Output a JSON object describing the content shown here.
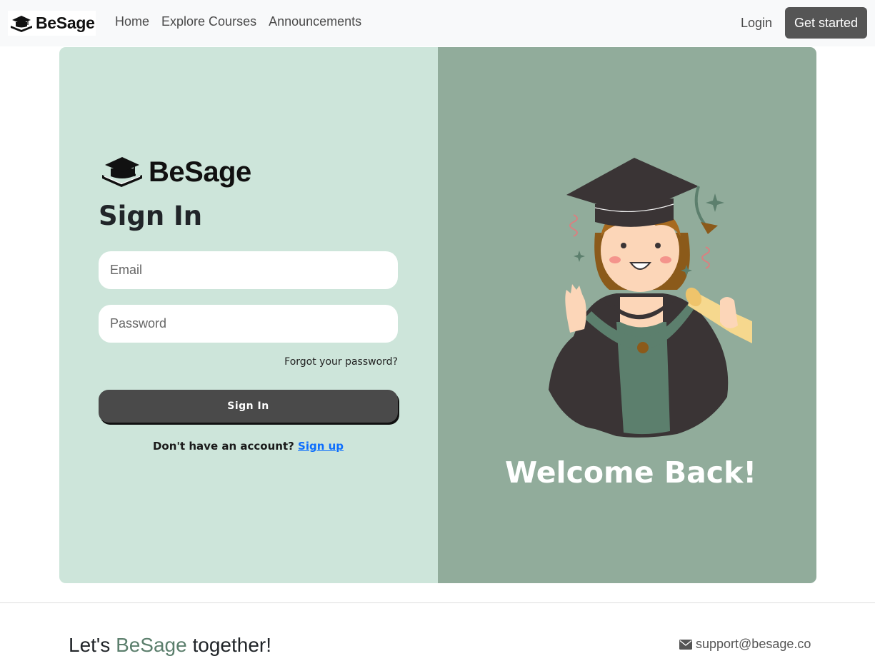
{
  "navbar": {
    "brand": "BeSage",
    "links": [
      "Home",
      "Explore Courses",
      "Announcements"
    ],
    "login": "Login",
    "get_started": "Get started"
  },
  "signin": {
    "brand": "BeSage",
    "title": "Sign In",
    "email_placeholder": "Email",
    "password_placeholder": "Password",
    "forgot": "Forgot your password?",
    "button": "Sign In",
    "no_account": "Don't have an account?",
    "signup": "Sign up"
  },
  "welcome": {
    "text": "Welcome Back!"
  },
  "footer": {
    "tag_before": "Let's",
    "tag_accent": "BeSage",
    "tag_after": "together!",
    "email": "support@besage.co"
  },
  "colors": {
    "left_pane": "#cde5da",
    "right_pane": "#91ac9b",
    "accent": "#5c7f6d",
    "button": "#4a4a4a",
    "link": "#0d6efd"
  },
  "icons": [
    "graduation-cap-book-icon",
    "envelope-icon"
  ]
}
